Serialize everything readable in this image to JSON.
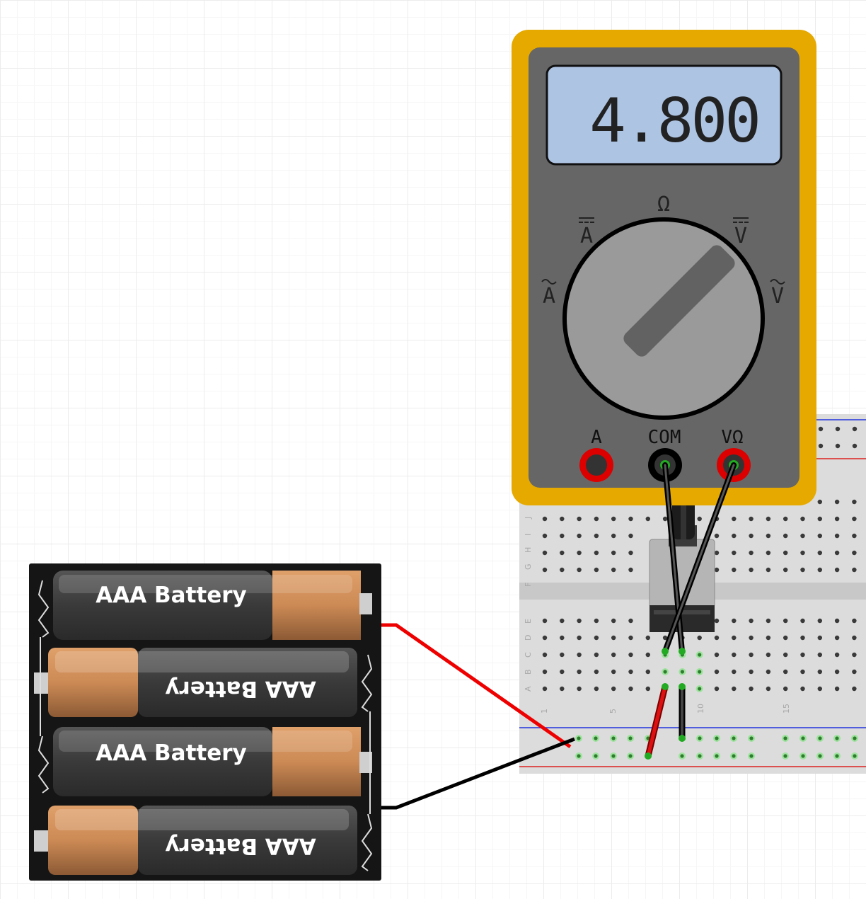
{
  "multimeter": {
    "display_value": "4.800",
    "dial_symbols": {
      "ohm": "Ω",
      "dc_amps": "A",
      "ac_amps": "A",
      "dc_volts": "V",
      "ac_volts": "V"
    },
    "jacks": {
      "amps": "A",
      "common": "COM",
      "volt_ohm": "VΩ"
    },
    "colors": {
      "case": "#e5a900",
      "body": "#666666",
      "lcd": "#aec4e3"
    }
  },
  "battery_pack": {
    "cells": [
      {
        "label": "AAA Battery",
        "orientation": "normal"
      },
      {
        "label": "AAA Battery",
        "orientation": "flipped"
      },
      {
        "label": "AAA Battery",
        "orientation": "normal"
      },
      {
        "label": "AAA Battery",
        "orientation": "flipped"
      }
    ]
  },
  "breadboard": {
    "row_letters": [
      "J",
      "I",
      "H",
      "G",
      "F",
      "E",
      "D",
      "C",
      "B",
      "A"
    ],
    "column_numbers": [
      "1",
      "5",
      "10",
      "15"
    ]
  },
  "wires": {
    "colors": {
      "positive": "#ee0000",
      "negative": "#000000",
      "probe": "#222222"
    }
  }
}
